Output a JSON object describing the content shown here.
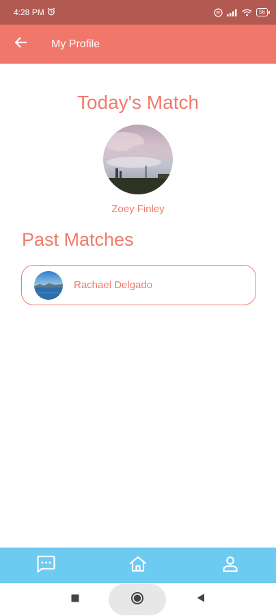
{
  "status_bar": {
    "time": "4:28 PM",
    "battery": "56"
  },
  "app_bar": {
    "title": "My Profile"
  },
  "today": {
    "title": "Today's Match",
    "name": "Zoey Finley"
  },
  "past": {
    "title": "Past Matches",
    "items": [
      {
        "name": "Rachael Delgado"
      }
    ]
  },
  "icons": {
    "back": "arrow-left-icon",
    "alarm": "alarm-clock-icon",
    "registered": "registered-icon",
    "signal": "signal-bars-icon",
    "wifi": "wifi-icon",
    "battery": "battery-icon",
    "chat": "chat-icon",
    "home": "home-icon",
    "person": "person-icon",
    "square": "recents-square-icon",
    "circle": "home-circle-icon",
    "triangle": "back-triangle-icon"
  },
  "colors": {
    "status_bar": "#b25a52",
    "app_bar": "#f2776b",
    "accent_text": "#ef7b6d",
    "bottom_nav": "#6dcaf1"
  }
}
